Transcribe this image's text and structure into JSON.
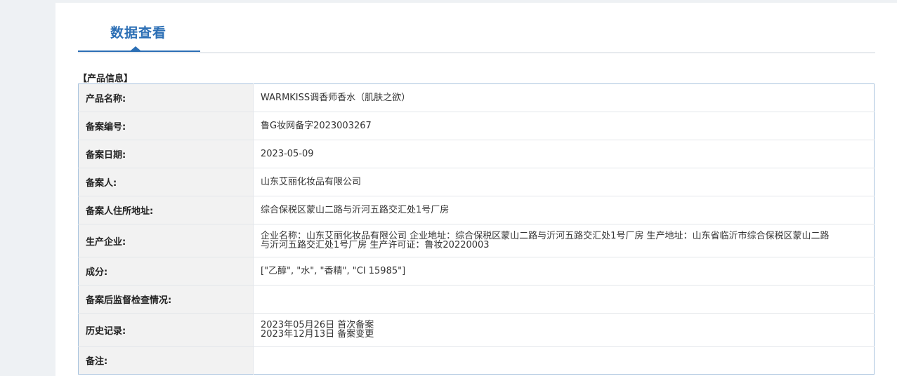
{
  "tab": {
    "label": "数据查看"
  },
  "section": {
    "title": "【产品信息】"
  },
  "rows": [
    {
      "label": "产品名称:",
      "value": "WARMKISS调香师香水（肌肤之欲）"
    },
    {
      "label": "备案编号:",
      "value": "鲁G妆网备字2023003267"
    },
    {
      "label": "备案日期:",
      "value": "2023-05-09"
    },
    {
      "label": "备案人:",
      "value": "山东艾丽化妆品有限公司"
    },
    {
      "label": "备案人住所地址:",
      "value": "综合保税区蒙山二路与沂河五路交汇处1号厂房"
    },
    {
      "label": "生产企业:",
      "value": "企业名称：山东艾丽化妆品有限公司 企业地址：综合保税区蒙山二路与沂河五路交汇处1号厂房 生产地址：山东省临沂市综合保税区蒙山二路与沂河五路交汇处1号厂房 生产许可证：鲁妆20220003"
    },
    {
      "label": "成分:",
      "value": "[\"乙醇\", \"水\", \"香精\", \"CI 15985\"]"
    },
    {
      "label": "备案后监督检查情况:",
      "value": ""
    },
    {
      "label": "历史记录:",
      "lines": [
        "2023年05月26日 首次备案",
        "2023年12月13日 备案变更"
      ]
    },
    {
      "label": "备注:",
      "value": ""
    }
  ],
  "colors": {
    "accent": "#2c6fb5",
    "table_border": "#a9c3de",
    "label_bg": "#f2f2f2",
    "page_bg": "#eef1f4"
  }
}
